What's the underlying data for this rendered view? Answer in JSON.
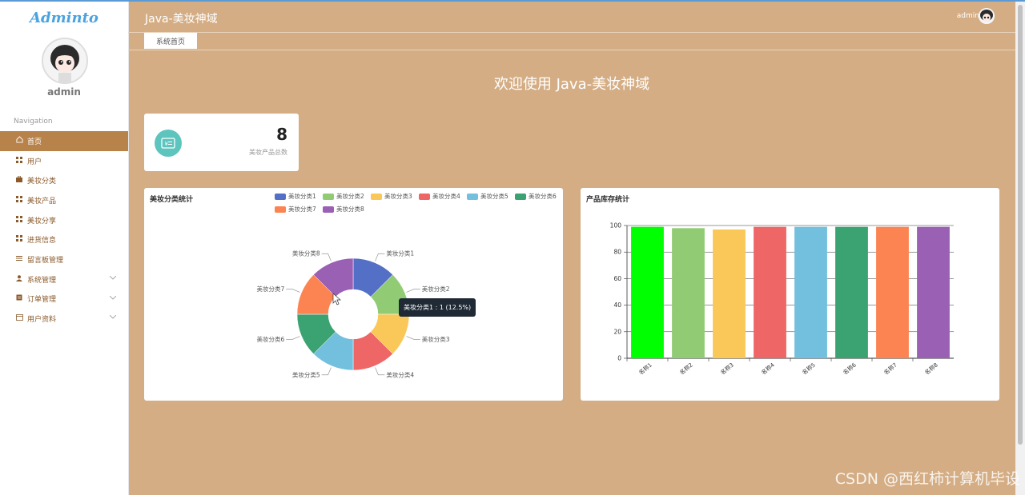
{
  "logo_text": "Adminto",
  "sidebar": {
    "username": "admin",
    "nav_title": "Navigation",
    "items": [
      {
        "label": "首页",
        "icon": "home-icon",
        "active": true
      },
      {
        "label": "用户",
        "icon": "grid-icon"
      },
      {
        "label": "美妆分类",
        "icon": "briefcase-icon"
      },
      {
        "label": "美妆产品",
        "icon": "grid-icon"
      },
      {
        "label": "美妆分享",
        "icon": "grid-icon"
      },
      {
        "label": "进货信息",
        "icon": "grid-icon"
      },
      {
        "label": "留言板管理",
        "icon": "sliders-icon"
      },
      {
        "label": "系统管理",
        "icon": "user-icon",
        "expandable": true
      },
      {
        "label": "订单管理",
        "icon": "clipboard-icon",
        "expandable": true
      },
      {
        "label": "用户资料",
        "icon": "card-icon",
        "expandable": true
      }
    ]
  },
  "header": {
    "title": "Java-美妆神域",
    "user": "admin"
  },
  "tabs": [
    {
      "label": "系统首页"
    }
  ],
  "welcome": "欢迎使用 Java-美妆神域",
  "stat_card": {
    "value": "8",
    "label": "美妆产品总数",
    "icon": "product-icon"
  },
  "pie_panel": {
    "title": "美妆分类统计",
    "tooltip": "美妆分类1 : 1 (12.5%)"
  },
  "bar_panel": {
    "title": "产品库存统计"
  },
  "watermark": "CSDN @西红柿计算机毕设",
  "colors": {
    "background": "#d4ad84",
    "active_nav": "#b8834a",
    "stat_icon": "#5ec4be"
  },
  "chart_data": [
    {
      "type": "pie",
      "title": "美妆分类统计",
      "categories": [
        "美妆分类1",
        "美妆分类2",
        "美妆分类3",
        "美妆分类4",
        "美妆分类5",
        "美妆分类6",
        "美妆分类7",
        "美妆分类8"
      ],
      "values": [
        1,
        1,
        1,
        1,
        1,
        1,
        1,
        1
      ],
      "colors": [
        "#5470c6",
        "#91cc75",
        "#fac858",
        "#ee6666",
        "#73c0de",
        "#3ba272",
        "#fc8452",
        "#9a60b4"
      ],
      "legend": "top-right",
      "donut": true
    },
    {
      "type": "bar",
      "title": "产品库存统计",
      "categories": [
        "名称1",
        "名称2",
        "名称3",
        "名称4",
        "名称5",
        "名称6",
        "名称7",
        "名称8"
      ],
      "values": [
        99,
        98,
        97,
        99,
        99,
        99,
        99,
        99
      ],
      "colors": [
        "#00ff00",
        "#91cc75",
        "#fac858",
        "#ee6666",
        "#73c0de",
        "#3ba272",
        "#fc8452",
        "#9a60b4"
      ],
      "ylim": [
        0,
        100
      ],
      "yticks": [
        0,
        20,
        40,
        60,
        80,
        100
      ],
      "grid": true
    }
  ]
}
